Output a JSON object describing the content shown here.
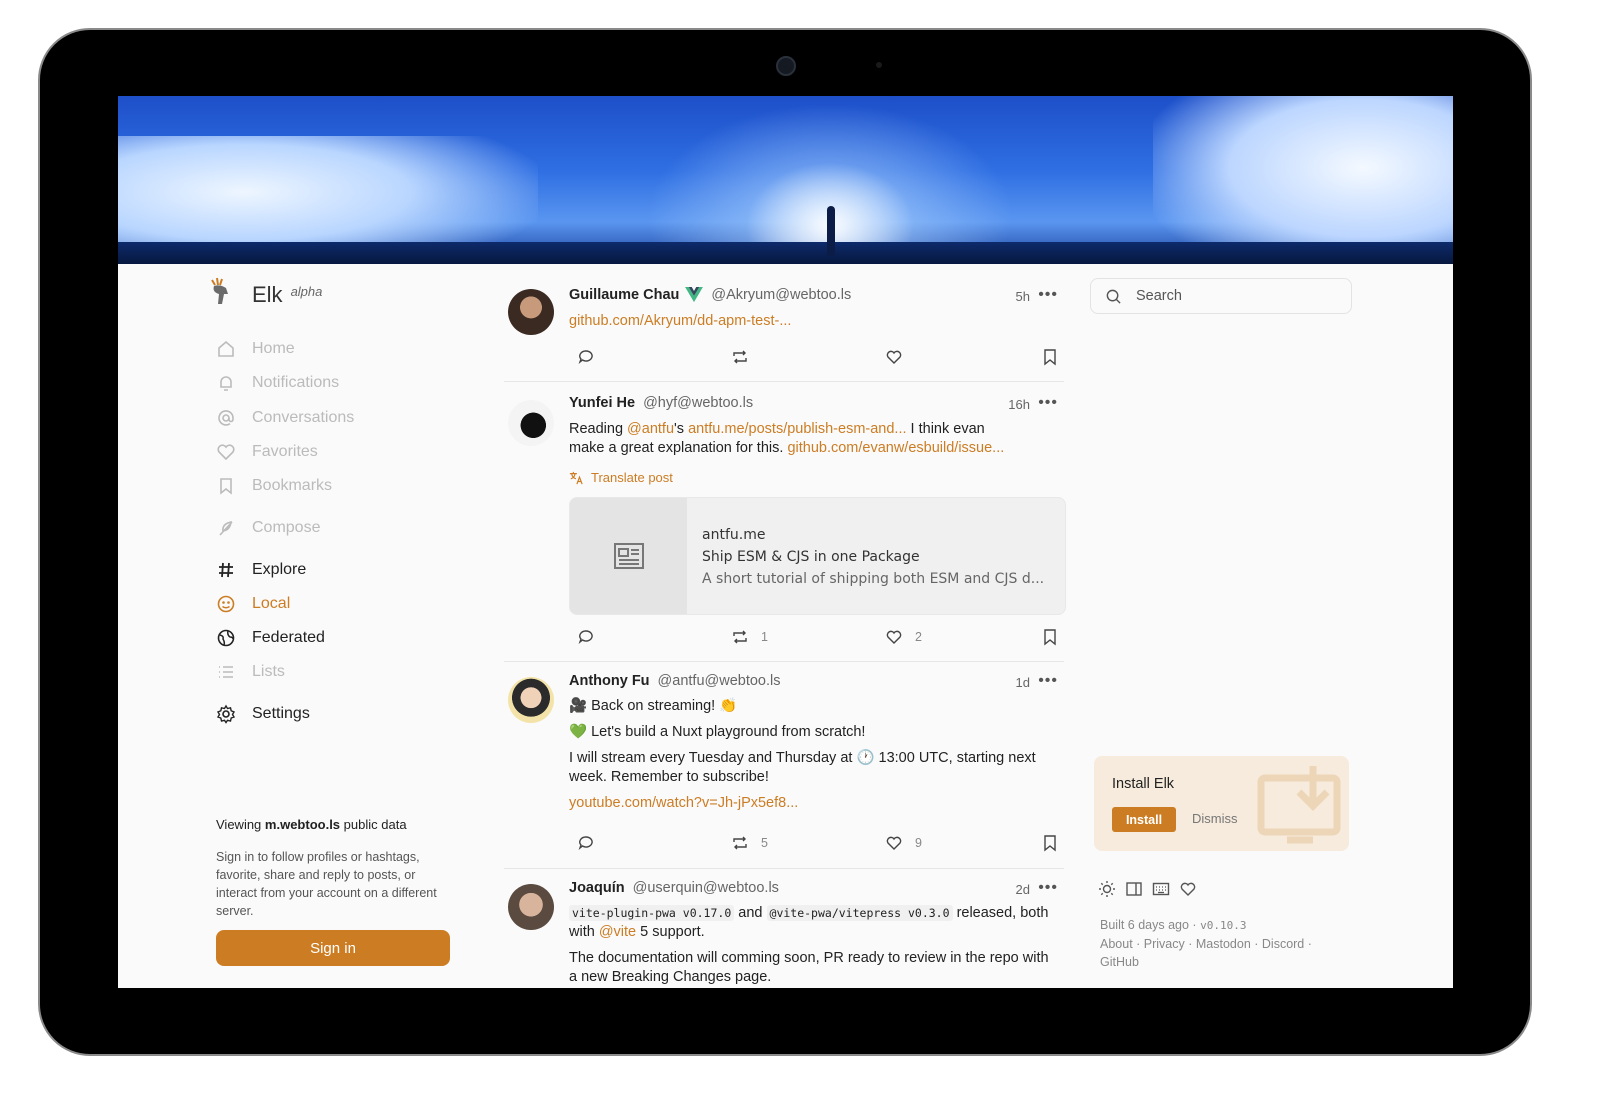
{
  "app": {
    "name": "Elk",
    "tag": "alpha"
  },
  "nav": [
    {
      "label": "Home",
      "icon": "home-icon",
      "state": "disabled"
    },
    {
      "label": "Notifications",
      "icon": "bell-icon",
      "state": "disabled"
    },
    {
      "label": "Conversations",
      "icon": "at-icon",
      "state": "disabled"
    },
    {
      "label": "Favorites",
      "icon": "heart-icon",
      "state": "disabled"
    },
    {
      "label": "Bookmarks",
      "icon": "bookmark-icon",
      "state": "disabled"
    },
    {
      "label": "Compose",
      "icon": "feather-icon",
      "state": "disabled"
    },
    {
      "label": "Explore",
      "icon": "hash-icon",
      "state": "normal"
    },
    {
      "label": "Local",
      "icon": "local-icon",
      "state": "active"
    },
    {
      "label": "Federated",
      "icon": "globe-icon",
      "state": "normal"
    },
    {
      "label": "Lists",
      "icon": "list-icon",
      "state": "disabled"
    },
    {
      "label": "Settings",
      "icon": "gear-icon",
      "state": "normal"
    }
  ],
  "info": {
    "viewing_prefix": "Viewing",
    "server": "m.webtoo.ls",
    "viewing_suffix": "public data",
    "description": "Sign in to follow profiles or hashtags, favorite, share and reply to posts, or interact from your account on a different server.",
    "signin": "Sign in"
  },
  "posts": [
    {
      "name": "Guillaume Chau",
      "handle": "@Akryum@webtoo.ls",
      "time": "5h",
      "link": "github.com/Akryum/dd-apm-test-...",
      "reblogs": "",
      "favs": ""
    },
    {
      "name": "Yunfei He",
      "handle": "@hyf@webtoo.ls",
      "time": "16h",
      "text1": "Reading",
      "mention": "@antfu",
      "text2": "'s",
      "link1": "antfu.me/posts/publish-esm-and...",
      "text3": "I think evan",
      "text4": "make a great explanation for this.",
      "link2": "github.com/evanw/esbuild/issue...",
      "translate": "Translate post",
      "card": {
        "domain": "antfu.me",
        "title": "Ship ESM & CJS in one Package",
        "desc": "A short tutorial of shipping both ESM and CJS d..."
      },
      "reblogs": "1",
      "favs": "2"
    },
    {
      "name": "Anthony Fu",
      "handle": "@antfu@webtoo.ls",
      "time": "1d",
      "line1": "🎥 Back on streaming! 👏",
      "line2": "💚 Let's build a Nuxt playground from scratch!",
      "line3": "I will stream every Tuesday and Thursday at 🕐 13:00 UTC, starting next",
      "line4": "week. Remember to subscribe!",
      "link": "youtube.com/watch?v=Jh-jPx5ef8...",
      "reblogs": "5",
      "favs": "9"
    },
    {
      "name": "Joaquín",
      "handle": "@userquin@webtoo.ls",
      "time": "2d",
      "code1": "vite-plugin-pwa v0.17.0",
      "and": "and",
      "code2": "@vite-pwa/vitepress v0.3.0",
      "text1": "released, both",
      "text2": "with",
      "mention": "@vite",
      "text3": "5 support.",
      "line3": "The documentation will comming soon, PR ready to review in the repo with",
      "line4": "a new Breaking Changes page."
    }
  ],
  "search": {
    "placeholder": "Search"
  },
  "install": {
    "title": "Install Elk",
    "button": "Install",
    "dismiss": "Dismiss"
  },
  "footer": {
    "built": "Built 6 days ago ·",
    "version": "v0.10.3",
    "links": [
      "About",
      "Privacy",
      "Mastodon",
      "Discord",
      "GitHub"
    ]
  },
  "colors": {
    "accent": "#cc7d24",
    "install_bg": "#f6ebdc"
  }
}
